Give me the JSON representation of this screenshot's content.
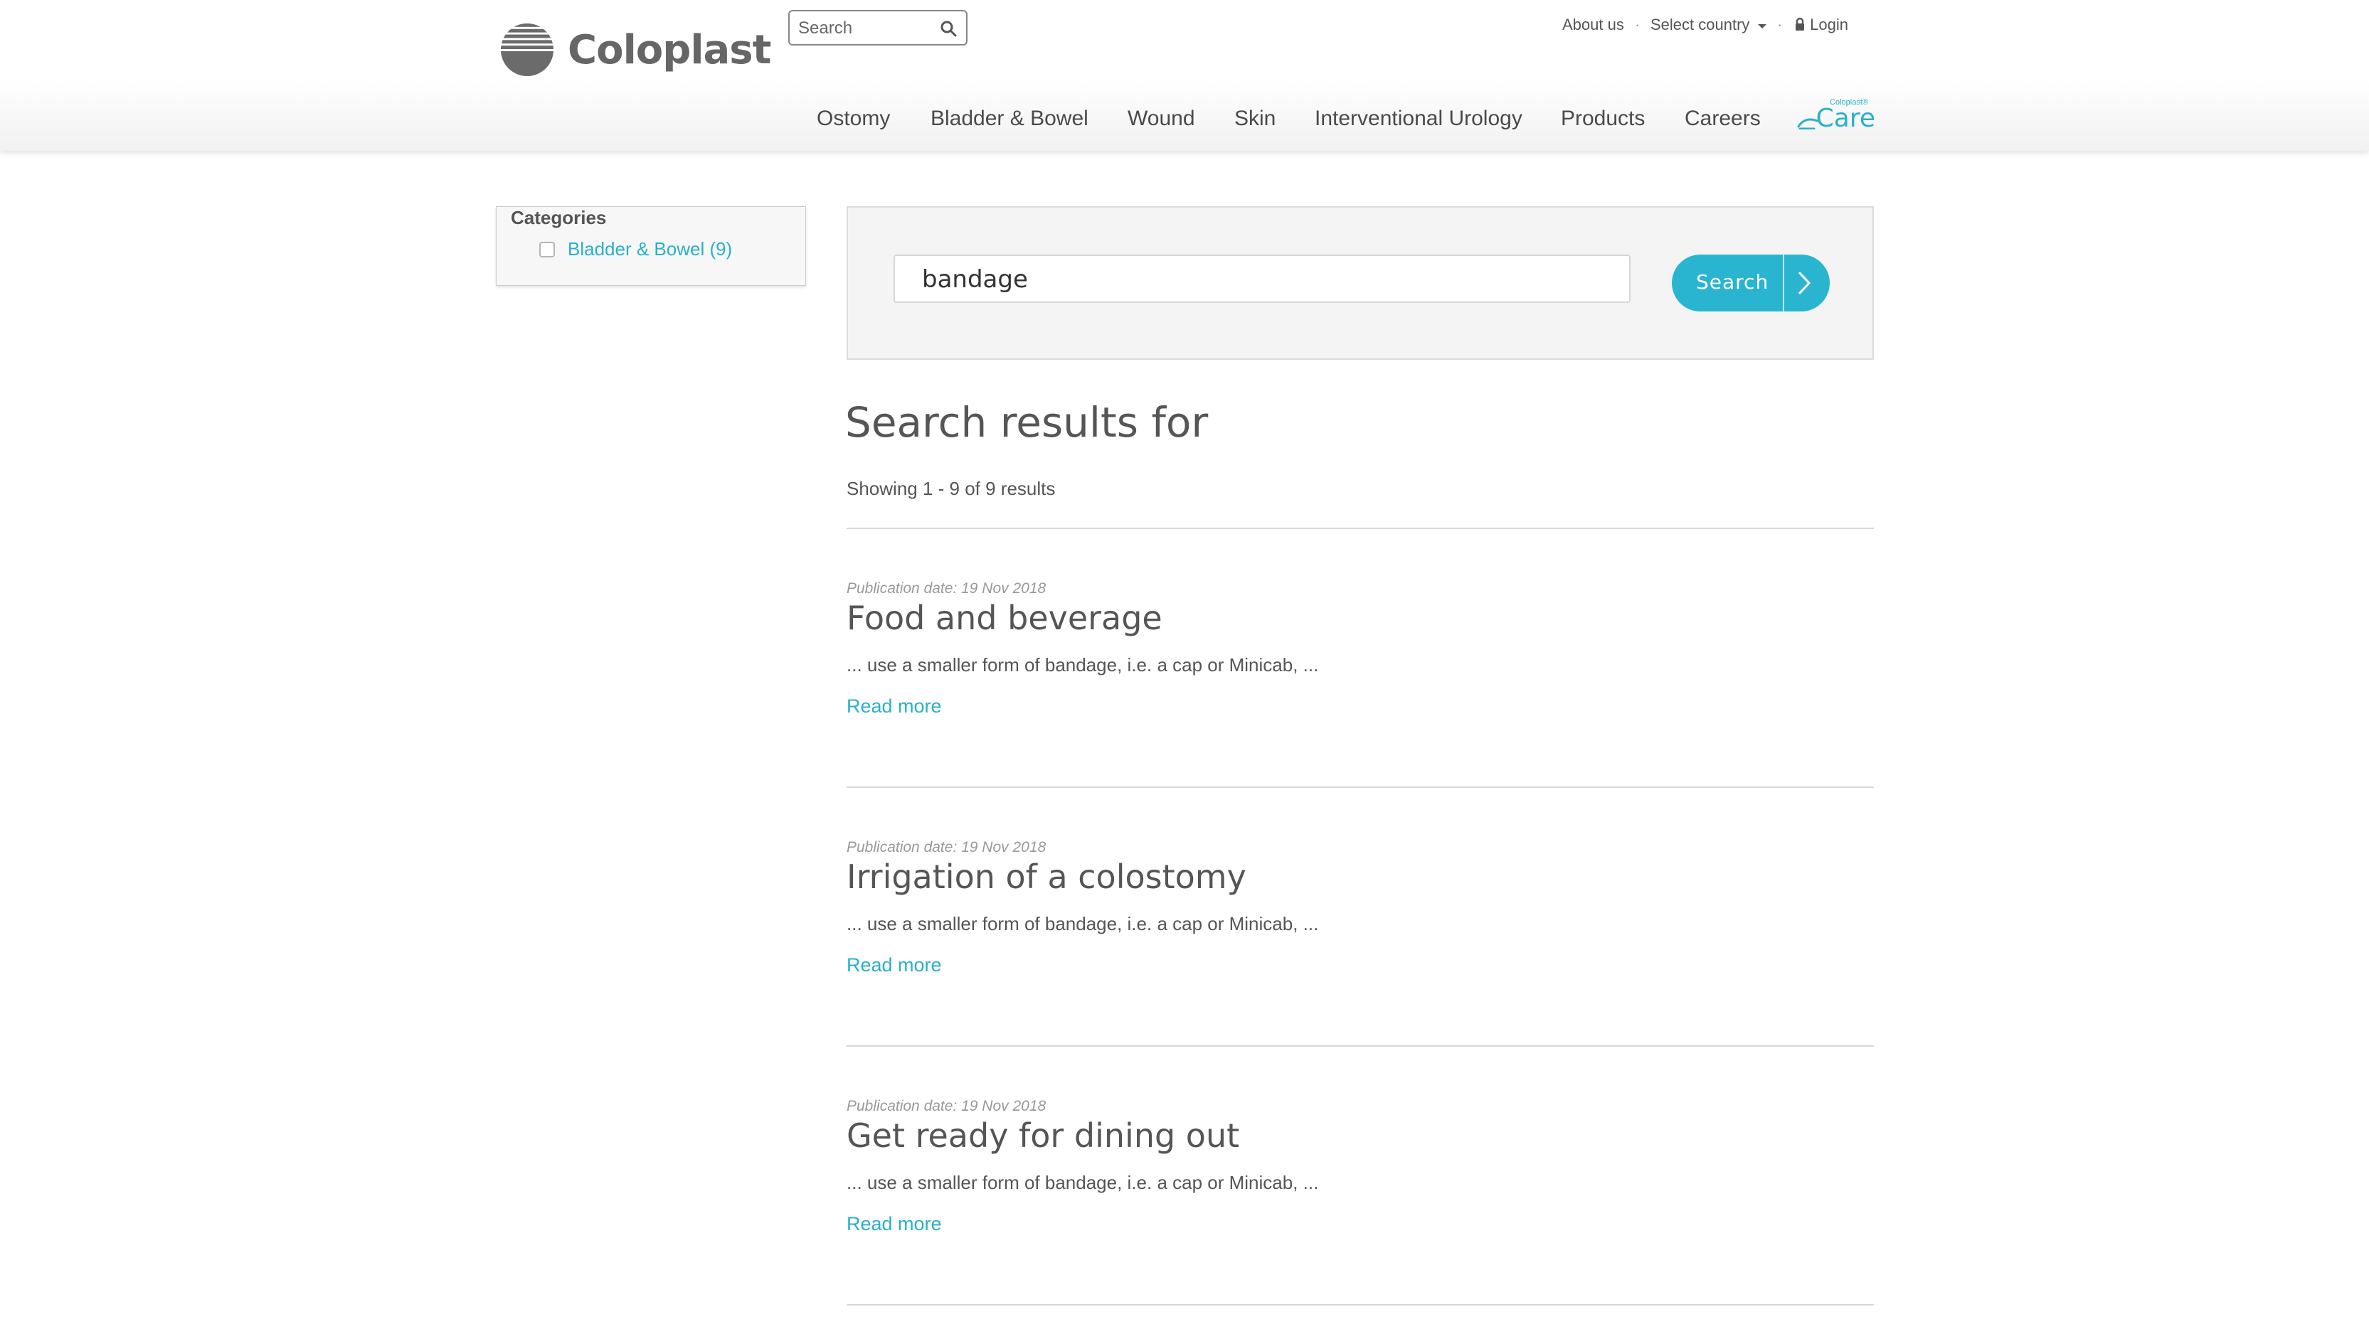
{
  "header": {
    "brand": "Coloplast",
    "search": {
      "placeholder": "Search",
      "value": ""
    },
    "utility": {
      "about": "About us",
      "country": "Select country",
      "login": "Login",
      "separator": "·"
    },
    "nav": [
      "Ostomy",
      "Bladder & Bowel",
      "Wound",
      "Skin",
      "Interventional Urology",
      "Products",
      "Careers"
    ],
    "care_logo": {
      "small": "Coloplast®",
      "big": "Care"
    }
  },
  "sidebar": {
    "title": "Categories",
    "items": [
      {
        "label": "Bladder & Bowel (9)",
        "checked": false
      }
    ]
  },
  "search_panel": {
    "query": "bandage",
    "button": "Search"
  },
  "results": {
    "heading": "Search results for",
    "count": "Showing 1 - 9 of 9 results",
    "items": [
      {
        "date": "Publication date: 19 Nov 2018",
        "title": "Food and beverage",
        "snippet": "... use a smaller form of bandage, i.e. a cap or Minicab, ...",
        "link": "Read more"
      },
      {
        "date": "Publication date: 19 Nov 2018",
        "title": "Irrigation of a colostomy",
        "snippet": "... use a smaller form of bandage, i.e. a cap or Minicab, ...",
        "link": "Read more"
      },
      {
        "date": "Publication date: 19 Nov 2018",
        "title": "Get ready for dining out",
        "snippet": "... use a smaller form of bandage, i.e. a cap or Minicab, ...",
        "link": "Read more"
      }
    ]
  },
  "colors": {
    "accent": "#29b0c9",
    "text": "#555555",
    "muted": "#999999"
  },
  "icons": [
    "coloplast-logo-icon",
    "search-icon",
    "caret-down-icon",
    "lock-icon",
    "care-logo-icon",
    "checkbox-icon",
    "chevron-right-icon"
  ]
}
